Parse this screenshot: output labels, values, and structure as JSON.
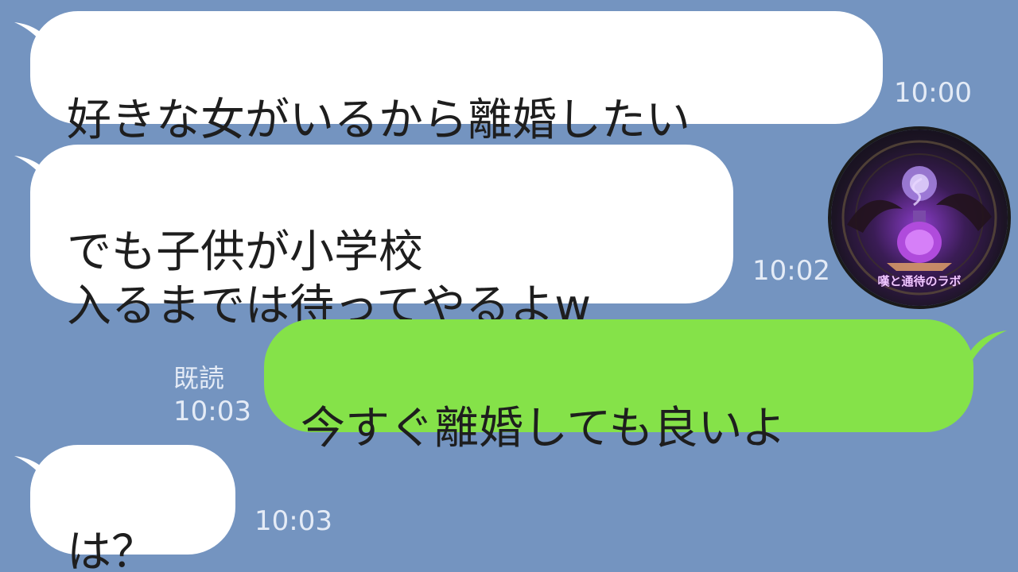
{
  "messages": [
    {
      "text": "好きな女がいるから離婚したい",
      "time": "10:00"
    },
    {
      "text": "でも子供が小学校\n入るまでは待ってやるよw",
      "time": "10:02"
    },
    {
      "text": "今すぐ離婚しても良いよ",
      "read_label": "既読",
      "time": "10:03"
    },
    {
      "text": "は？",
      "time": "10:03"
    }
  ],
  "avatar": {
    "label": "嘆と通待のラボ",
    "icon": "potion-flask-icon"
  },
  "colors": {
    "background": "#7494c0",
    "incoming_bubble": "#ffffff",
    "outgoing_bubble": "#85e249",
    "timestamp": "#e4ebf6"
  }
}
